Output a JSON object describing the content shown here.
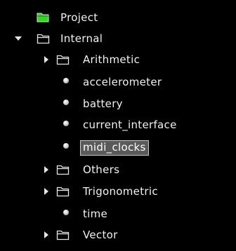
{
  "colors": {
    "background": "#000000",
    "text": "#f2f2f2",
    "project_folder": "#39d22b",
    "selection_background": "#5a5a5a",
    "selection_border": "#c9c9c9"
  },
  "tree": {
    "project": {
      "label": "Project",
      "icon": "filled-folder-icon"
    },
    "internal": {
      "label": "Internal",
      "icon": "folder-icon",
      "expander": "expanded-arrow-icon"
    },
    "arithmetic": {
      "label": "Arithmetic",
      "icon": "folder-icon",
      "expander": "collapsed-arrow-icon"
    },
    "accelerometer": {
      "label": "accelerometer",
      "icon": "bullet-icon"
    },
    "battery": {
      "label": "battery",
      "icon": "bullet-icon"
    },
    "current_interface": {
      "label": "current_interface",
      "icon": "bullet-icon"
    },
    "midi_clocks": {
      "label": "midi_clocks",
      "icon": "bullet-icon",
      "selected": true
    },
    "others": {
      "label": "Others",
      "icon": "folder-icon",
      "expander": "collapsed-arrow-icon"
    },
    "trigonometric": {
      "label": "Trigonometric",
      "icon": "folder-icon",
      "expander": "collapsed-arrow-icon"
    },
    "time": {
      "label": "time",
      "icon": "bullet-icon"
    },
    "vector": {
      "label": "Vector",
      "icon": "folder-icon",
      "expander": "collapsed-arrow-icon"
    }
  }
}
